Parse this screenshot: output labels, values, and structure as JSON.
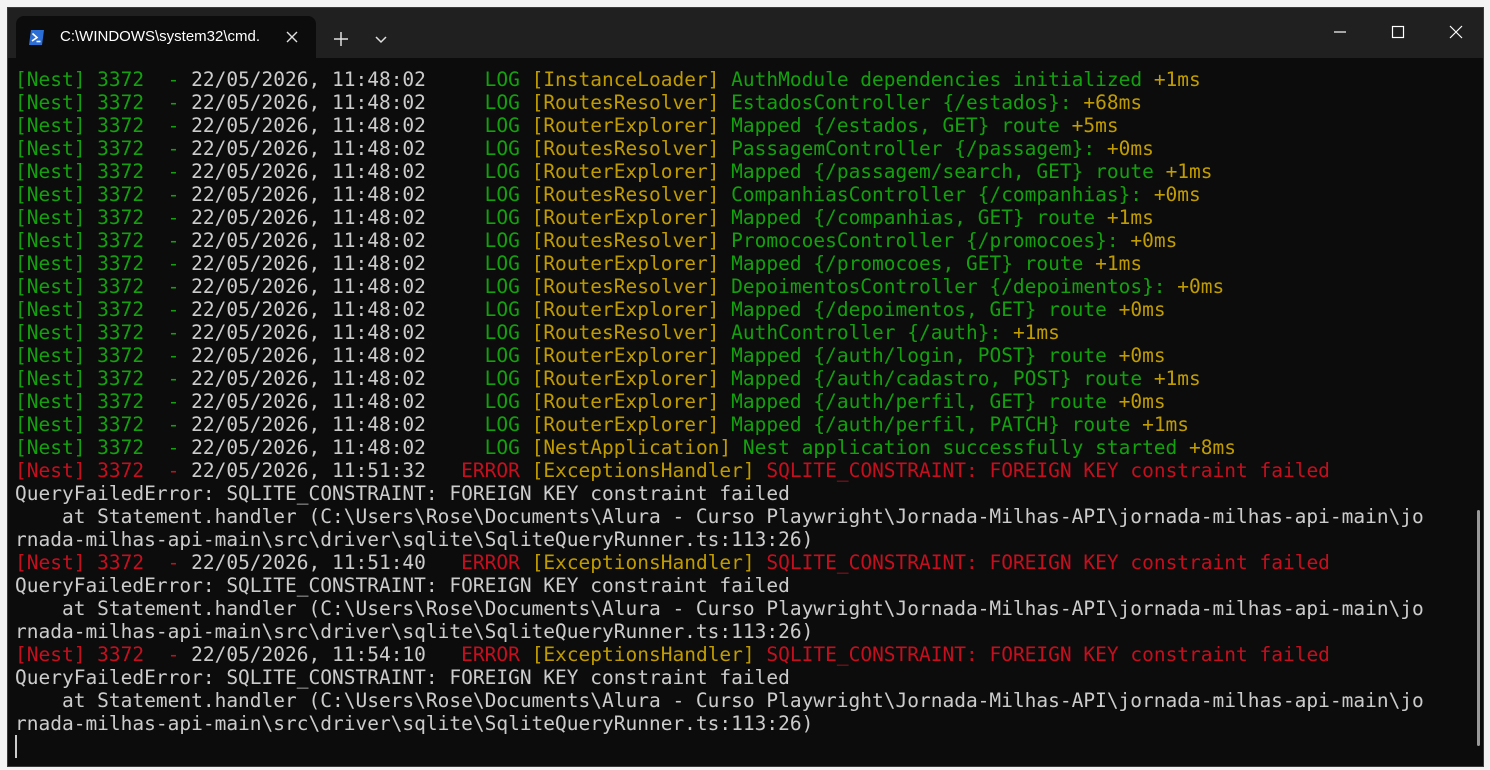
{
  "window": {
    "tab_title": "C:\\WINDOWS\\system32\\cmd.",
    "tab_icon": "powershell-icon",
    "new_tab_icon": "plus-icon",
    "dropdown_icon": "chevron-down-icon",
    "caption_buttons": [
      "minimize-icon",
      "maximize-icon",
      "close-icon"
    ]
  },
  "colors": {
    "green": "#13a10e",
    "yellow": "#c19c00",
    "red": "#c50f1f",
    "gray": "#cccccc",
    "background": "#0c0c0c",
    "titlebar": "#202020"
  },
  "log": [
    {
      "type": "log",
      "prefix": "[Nest] 3372  - ",
      "ts": "22/05/2026, 11:48:02     ",
      "level": "LOG ",
      "ctx": "[InstanceLoader] ",
      "msg": "AuthModule dependencies initialized ",
      "extra": "+1ms"
    },
    {
      "type": "log",
      "prefix": "[Nest] 3372  - ",
      "ts": "22/05/2026, 11:48:02     ",
      "level": "LOG ",
      "ctx": "[RoutesResolver] ",
      "msg": "EstadosController {/estados}: ",
      "extra": "+68ms"
    },
    {
      "type": "log",
      "prefix": "[Nest] 3372  - ",
      "ts": "22/05/2026, 11:48:02     ",
      "level": "LOG ",
      "ctx": "[RouterExplorer] ",
      "msg": "Mapped {/estados, GET} route ",
      "extra": "+5ms"
    },
    {
      "type": "log",
      "prefix": "[Nest] 3372  - ",
      "ts": "22/05/2026, 11:48:02     ",
      "level": "LOG ",
      "ctx": "[RoutesResolver] ",
      "msg": "PassagemController {/passagem}: ",
      "extra": "+0ms"
    },
    {
      "type": "log",
      "prefix": "[Nest] 3372  - ",
      "ts": "22/05/2026, 11:48:02     ",
      "level": "LOG ",
      "ctx": "[RouterExplorer] ",
      "msg": "Mapped {/passagem/search, GET} route ",
      "extra": "+1ms"
    },
    {
      "type": "log",
      "prefix": "[Nest] 3372  - ",
      "ts": "22/05/2026, 11:48:02     ",
      "level": "LOG ",
      "ctx": "[RoutesResolver] ",
      "msg": "CompanhiasController {/companhias}: ",
      "extra": "+0ms"
    },
    {
      "type": "log",
      "prefix": "[Nest] 3372  - ",
      "ts": "22/05/2026, 11:48:02     ",
      "level": "LOG ",
      "ctx": "[RouterExplorer] ",
      "msg": "Mapped {/companhias, GET} route ",
      "extra": "+1ms"
    },
    {
      "type": "log",
      "prefix": "[Nest] 3372  - ",
      "ts": "22/05/2026, 11:48:02     ",
      "level": "LOG ",
      "ctx": "[RoutesResolver] ",
      "msg": "PromocoesController {/promocoes}: ",
      "extra": "+0ms"
    },
    {
      "type": "log",
      "prefix": "[Nest] 3372  - ",
      "ts": "22/05/2026, 11:48:02     ",
      "level": "LOG ",
      "ctx": "[RouterExplorer] ",
      "msg": "Mapped {/promocoes, GET} route ",
      "extra": "+1ms"
    },
    {
      "type": "log",
      "prefix": "[Nest] 3372  - ",
      "ts": "22/05/2026, 11:48:02     ",
      "level": "LOG ",
      "ctx": "[RoutesResolver] ",
      "msg": "DepoimentosController {/depoimentos}: ",
      "extra": "+0ms"
    },
    {
      "type": "log",
      "prefix": "[Nest] 3372  - ",
      "ts": "22/05/2026, 11:48:02     ",
      "level": "LOG ",
      "ctx": "[RouterExplorer] ",
      "msg": "Mapped {/depoimentos, GET} route ",
      "extra": "+0ms"
    },
    {
      "type": "log",
      "prefix": "[Nest] 3372  - ",
      "ts": "22/05/2026, 11:48:02     ",
      "level": "LOG ",
      "ctx": "[RoutesResolver] ",
      "msg": "AuthController {/auth}: ",
      "extra": "+1ms"
    },
    {
      "type": "log",
      "prefix": "[Nest] 3372  - ",
      "ts": "22/05/2026, 11:48:02     ",
      "level": "LOG ",
      "ctx": "[RouterExplorer] ",
      "msg": "Mapped {/auth/login, POST} route ",
      "extra": "+0ms"
    },
    {
      "type": "log",
      "prefix": "[Nest] 3372  - ",
      "ts": "22/05/2026, 11:48:02     ",
      "level": "LOG ",
      "ctx": "[RouterExplorer] ",
      "msg": "Mapped {/auth/cadastro, POST} route ",
      "extra": "+1ms"
    },
    {
      "type": "log",
      "prefix": "[Nest] 3372  - ",
      "ts": "22/05/2026, 11:48:02     ",
      "level": "LOG ",
      "ctx": "[RouterExplorer] ",
      "msg": "Mapped {/auth/perfil, GET} route ",
      "extra": "+0ms"
    },
    {
      "type": "log",
      "prefix": "[Nest] 3372  - ",
      "ts": "22/05/2026, 11:48:02     ",
      "level": "LOG ",
      "ctx": "[RouterExplorer] ",
      "msg": "Mapped {/auth/perfil, PATCH} route ",
      "extra": "+1ms"
    },
    {
      "type": "log",
      "prefix": "[Nest] 3372  - ",
      "ts": "22/05/2026, 11:48:02     ",
      "level": "LOG ",
      "ctx": "[NestApplication] ",
      "msg": "Nest application successfully started ",
      "extra": "+8ms"
    },
    {
      "type": "error",
      "prefix": "[Nest] 3372  - ",
      "ts": "22/05/2026, 11:51:32   ",
      "level": "ERROR ",
      "ctx": "[ExceptionsHandler] ",
      "msg": "SQLITE_CONSTRAINT: FOREIGN KEY constraint failed"
    },
    {
      "type": "plain",
      "text": "QueryFailedError: SQLITE_CONSTRAINT: FOREIGN KEY constraint failed"
    },
    {
      "type": "plain",
      "text": "    at Statement.handler (C:\\Users\\Rose\\Documents\\Alura - Curso Playwright\\Jornada-Milhas-API\\jornada-milhas-api-main\\jo"
    },
    {
      "type": "plain",
      "text": "rnada-milhas-api-main\\src\\driver\\sqlite\\SqliteQueryRunner.ts:113:26)"
    },
    {
      "type": "error",
      "prefix": "[Nest] 3372  - ",
      "ts": "22/05/2026, 11:51:40   ",
      "level": "ERROR ",
      "ctx": "[ExceptionsHandler] ",
      "msg": "SQLITE_CONSTRAINT: FOREIGN KEY constraint failed"
    },
    {
      "type": "plain",
      "text": "QueryFailedError: SQLITE_CONSTRAINT: FOREIGN KEY constraint failed"
    },
    {
      "type": "plain",
      "text": "    at Statement.handler (C:\\Users\\Rose\\Documents\\Alura - Curso Playwright\\Jornada-Milhas-API\\jornada-milhas-api-main\\jo"
    },
    {
      "type": "plain",
      "text": "rnada-milhas-api-main\\src\\driver\\sqlite\\SqliteQueryRunner.ts:113:26)"
    },
    {
      "type": "error",
      "prefix": "[Nest] 3372  - ",
      "ts": "22/05/2026, 11:54:10   ",
      "level": "ERROR ",
      "ctx": "[ExceptionsHandler] ",
      "msg": "SQLITE_CONSTRAINT: FOREIGN KEY constraint failed"
    },
    {
      "type": "plain",
      "text": "QueryFailedError: SQLITE_CONSTRAINT: FOREIGN KEY constraint failed"
    },
    {
      "type": "plain",
      "text": "    at Statement.handler (C:\\Users\\Rose\\Documents\\Alura - Curso Playwright\\Jornada-Milhas-API\\jornada-milhas-api-main\\jo"
    },
    {
      "type": "plain",
      "text": "rnada-milhas-api-main\\src\\driver\\sqlite\\SqliteQueryRunner.ts:113:26)"
    }
  ]
}
